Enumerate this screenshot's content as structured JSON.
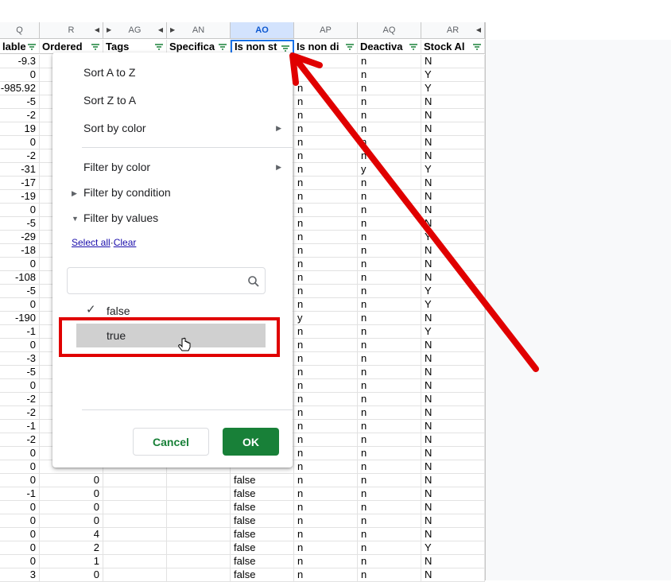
{
  "columns": [
    {
      "letter": "Q",
      "header": "lable"
    },
    {
      "letter": "R",
      "header": "Ordered"
    },
    {
      "letter": "AG",
      "header": "Tags"
    },
    {
      "letter": "AN",
      "header": "Specifica"
    },
    {
      "letter": "AO",
      "header": "Is non st"
    },
    {
      "letter": "AP",
      "header": "Is non di"
    },
    {
      "letter": "AQ",
      "header": "Deactiva"
    },
    {
      "letter": "AR",
      "header": "Stock Al"
    }
  ],
  "rows": [
    {
      "q": "-9.3",
      "r": "",
      "ao": "",
      "ap": "",
      "aq": "n",
      "ar": "N"
    },
    {
      "q": "0",
      "r": "",
      "ao": "",
      "ap": "",
      "aq": "n",
      "ar": "Y"
    },
    {
      "q": "-985.92",
      "r": "",
      "ao": "",
      "ap": "n",
      "aq": "n",
      "ar": "Y"
    },
    {
      "q": "-5",
      "r": "",
      "ao": "",
      "ap": "n",
      "aq": "n",
      "ar": "N"
    },
    {
      "q": "-2",
      "r": "",
      "ao": "",
      "ap": "n",
      "aq": "n",
      "ar": "N"
    },
    {
      "q": "19",
      "r": "",
      "ao": "",
      "ap": "n",
      "aq": "n",
      "ar": "N"
    },
    {
      "q": "0",
      "r": "",
      "ao": "",
      "ap": "n",
      "aq": "n",
      "ar": "N"
    },
    {
      "q": "-2",
      "r": "",
      "ao": "",
      "ap": "n",
      "aq": "n",
      "ar": "N"
    },
    {
      "q": "-31",
      "r": "",
      "ao": "",
      "ap": "n",
      "aq": "y",
      "ar": "Y"
    },
    {
      "q": "-17",
      "r": "",
      "ao": "",
      "ap": "n",
      "aq": "n",
      "ar": "N"
    },
    {
      "q": "-19",
      "r": "",
      "ao": "",
      "ap": "n",
      "aq": "n",
      "ar": "N"
    },
    {
      "q": "0",
      "r": "",
      "ao": "",
      "ap": "n",
      "aq": "n",
      "ar": "N"
    },
    {
      "q": "-5",
      "r": "",
      "ao": "",
      "ap": "n",
      "aq": "n",
      "ar": "N"
    },
    {
      "q": "-29",
      "r": "",
      "ao": "",
      "ap": "n",
      "aq": "n",
      "ar": "Y"
    },
    {
      "q": "-18",
      "r": "",
      "ao": "",
      "ap": "n",
      "aq": "n",
      "ar": "N"
    },
    {
      "q": "0",
      "r": "",
      "ao": "",
      "ap": "n",
      "aq": "n",
      "ar": "N"
    },
    {
      "q": "-108",
      "r": "",
      "ao": "",
      "ap": "n",
      "aq": "n",
      "ar": "N"
    },
    {
      "q": "-5",
      "r": "",
      "ao": "",
      "ap": "n",
      "aq": "n",
      "ar": "Y"
    },
    {
      "q": "0",
      "r": "",
      "ao": "",
      "ap": "n",
      "aq": "n",
      "ar": "Y"
    },
    {
      "q": "-190",
      "r": "",
      "ao": "",
      "ap": "y",
      "aq": "n",
      "ar": "N"
    },
    {
      "q": "-1",
      "r": "",
      "ao": "",
      "ap": "n",
      "aq": "n",
      "ar": "Y"
    },
    {
      "q": "0",
      "r": "",
      "ao": "",
      "ap": "n",
      "aq": "n",
      "ar": "N"
    },
    {
      "q": "-3",
      "r": "",
      "ao": "",
      "ap": "n",
      "aq": "n",
      "ar": "N"
    },
    {
      "q": "-5",
      "r": "",
      "ao": "",
      "ap": "n",
      "aq": "n",
      "ar": "N"
    },
    {
      "q": "0",
      "r": "",
      "ao": "",
      "ap": "n",
      "aq": "n",
      "ar": "N"
    },
    {
      "q": "-2",
      "r": "",
      "ao": "",
      "ap": "n",
      "aq": "n",
      "ar": "N"
    },
    {
      "q": "-2",
      "r": "",
      "ao": "",
      "ap": "n",
      "aq": "n",
      "ar": "N"
    },
    {
      "q": "-1",
      "r": "",
      "ao": "",
      "ap": "n",
      "aq": "n",
      "ar": "N"
    },
    {
      "q": "-2",
      "r": "",
      "ao": "",
      "ap": "n",
      "aq": "n",
      "ar": "N"
    },
    {
      "q": "0",
      "r": "",
      "ao": "",
      "ap": "n",
      "aq": "n",
      "ar": "N"
    },
    {
      "q": "0",
      "r": "",
      "ao": "",
      "ap": "n",
      "aq": "n",
      "ar": "N"
    },
    {
      "q": "0",
      "r": "0",
      "ao": "false",
      "ap": "n",
      "aq": "n",
      "ar": "N"
    },
    {
      "q": "-1",
      "r": "0",
      "ao": "false",
      "ap": "n",
      "aq": "n",
      "ar": "N"
    },
    {
      "q": "0",
      "r": "0",
      "ao": "false",
      "ap": "n",
      "aq": "n",
      "ar": "N"
    },
    {
      "q": "0",
      "r": "0",
      "ao": "false",
      "ap": "n",
      "aq": "n",
      "ar": "N"
    },
    {
      "q": "0",
      "r": "4",
      "ao": "false",
      "ap": "n",
      "aq": "n",
      "ar": "N"
    },
    {
      "q": "0",
      "r": "2",
      "ao": "false",
      "ap": "n",
      "aq": "n",
      "ar": "Y"
    },
    {
      "q": "0",
      "r": "1",
      "ao": "false",
      "ap": "n",
      "aq": "n",
      "ar": "N"
    },
    {
      "q": "3",
      "r": "0",
      "ao": "false",
      "ap": "n",
      "aq": "n",
      "ar": "N"
    }
  ],
  "filter_menu": {
    "sort_a_z": "Sort A to Z",
    "sort_z_a": "Sort Z to A",
    "sort_by_color": "Sort by color",
    "filter_by_color": "Filter by color",
    "filter_by_condition": "Filter by condition",
    "filter_by_values": "Filter by values",
    "select_all": "Select all",
    "separator": "·",
    "clear": "Clear",
    "search_placeholder": "",
    "values": [
      {
        "label": "false",
        "checked": true
      },
      {
        "label": "true",
        "checked": false
      }
    ],
    "cancel_label": "Cancel",
    "ok_label": "OK"
  },
  "colors": {
    "accent_green": "#188038",
    "annotation_red": "#e00000",
    "selected_blue": "#1a73e8"
  }
}
